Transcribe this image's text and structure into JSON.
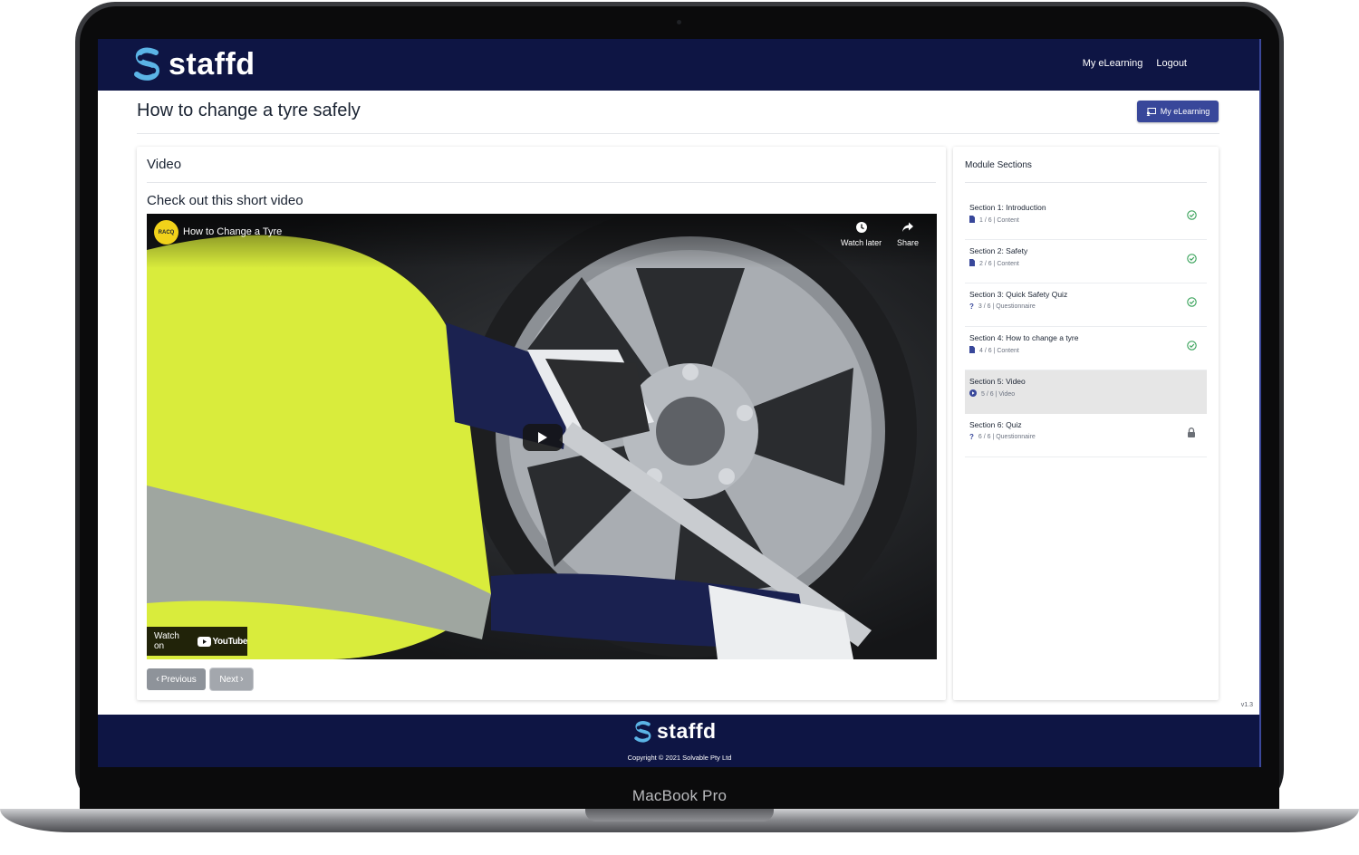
{
  "device": {
    "model_label": "MacBook Pro"
  },
  "navbar": {
    "brand": "staffd",
    "links": [
      "My eLearning",
      "Logout"
    ]
  },
  "page": {
    "title": "How to change a tyre safely",
    "header_button": "My eLearning"
  },
  "content": {
    "card_title": "Video",
    "video_heading": "Check out this short video",
    "video": {
      "channel_badge": "RACQ",
      "title": "How to Change a Tyre",
      "watch_later_label": "Watch later",
      "share_label": "Share",
      "watch_on_label": "Watch on",
      "youtube_label": "YouTube"
    },
    "buttons": {
      "previous": "Previous",
      "next": "Next"
    }
  },
  "sidebar": {
    "title": "Module Sections",
    "sections": [
      {
        "title": "Section 1: Introduction",
        "meta": "1 / 6 | Content",
        "type_icon": "document-icon",
        "status": "complete"
      },
      {
        "title": "Section 2: Safety",
        "meta": "2 / 6 | Content",
        "type_icon": "document-icon",
        "status": "complete"
      },
      {
        "title": "Section 3: Quick Safety Quiz",
        "meta": "3 / 6 | Questionnaire",
        "type_icon": "question-icon",
        "status": "complete"
      },
      {
        "title": "Section 4: How to change a tyre",
        "meta": "4 / 6 | Content",
        "type_icon": "document-icon",
        "status": "complete"
      },
      {
        "title": "Section 5: Video",
        "meta": "5 / 6 | Video",
        "type_icon": "play-circle-icon",
        "status": "active"
      },
      {
        "title": "Section 6: Quiz",
        "meta": "6 / 6 | Questionnaire",
        "type_icon": "question-icon",
        "status": "locked"
      }
    ]
  },
  "version": "v1.3",
  "footer": {
    "brand": "staffd",
    "copyright": "Copyright © 2021 Solvable Pty Ltd"
  },
  "colors": {
    "navy": "#0e1544",
    "accent": "#38479a",
    "success": "#3aa35b",
    "logo_blue": "#5bb4e6"
  }
}
